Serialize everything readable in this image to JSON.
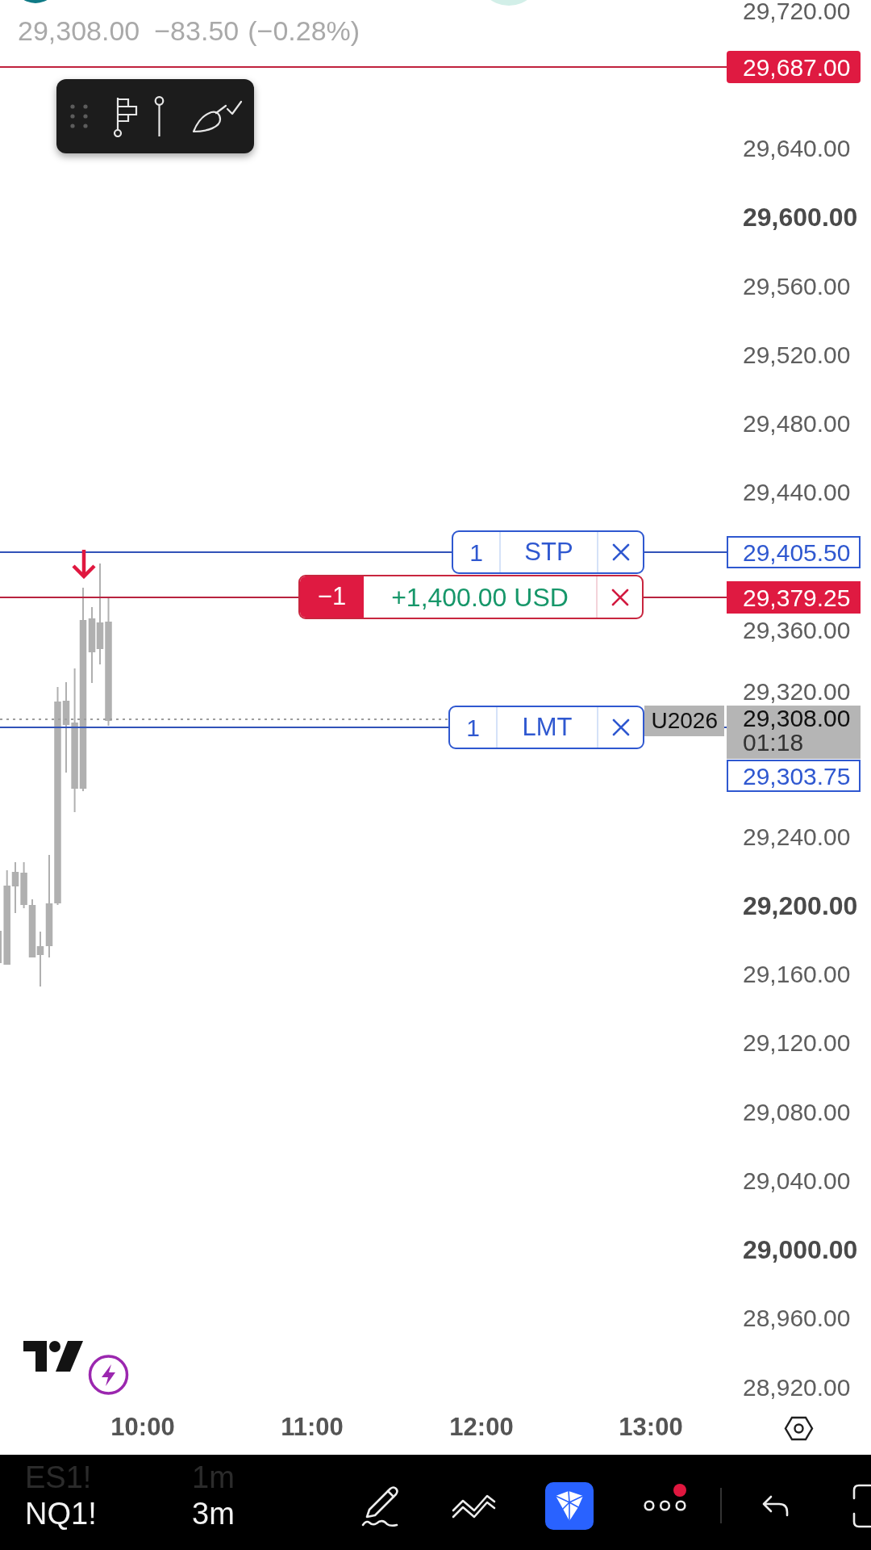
{
  "header": {
    "price": "29,308.00",
    "change": "−83.50",
    "change_percent": "(−0.28%)"
  },
  "price_lines": [
    {
      "kind": "price_line",
      "price": "29,687.00"
    },
    {
      "kind": "order",
      "quantity": "1",
      "order_type": "STP",
      "price": "29,405.50"
    },
    {
      "kind": "position",
      "quantity": "−1",
      "pnl": "+1,400.00 USD",
      "price": "29,379.25"
    },
    {
      "kind": "last_price",
      "symbol": "U2026",
      "price": "29,308.00",
      "countdown": "01:18"
    },
    {
      "kind": "order",
      "quantity": "1",
      "order_type": "LMT",
      "price": "29,303.75"
    }
  ],
  "price_axis": {
    "labels": [
      {
        "text": "29,720.00",
        "major": false
      },
      {
        "text": "29,640.00",
        "major": false
      },
      {
        "text": "29,600.00",
        "major": true
      },
      {
        "text": "29,560.00",
        "major": false
      },
      {
        "text": "29,520.00",
        "major": false
      },
      {
        "text": "29,480.00",
        "major": false
      },
      {
        "text": "29,440.00",
        "major": false
      },
      {
        "text": "29,360.00",
        "major": false
      },
      {
        "text": "29,320.00",
        "major": false
      },
      {
        "text": "29,240.00",
        "major": false
      },
      {
        "text": "29,200.00",
        "major": true
      },
      {
        "text": "29,160.00",
        "major": false
      },
      {
        "text": "29,120.00",
        "major": false
      },
      {
        "text": "29,080.00",
        "major": false
      },
      {
        "text": "29,040.00",
        "major": false
      },
      {
        "text": "29,000.00",
        "major": true
      },
      {
        "text": "28,960.00",
        "major": false
      },
      {
        "text": "28,920.00",
        "major": false
      }
    ]
  },
  "time_axis": {
    "labels": [
      "10:00",
      "11:00",
      "12:00",
      "13:00"
    ]
  },
  "bottom_bar": {
    "symbols": [
      {
        "label": "ES1!",
        "selected": false
      },
      {
        "label": "NQ1!",
        "selected": true
      }
    ],
    "intervals": [
      {
        "label": "1m",
        "selected": false
      },
      {
        "label": "3m",
        "selected": true
      }
    ],
    "tools": [
      {
        "kind": "draw",
        "selected": false,
        "notification": false
      },
      {
        "kind": "trend_lines",
        "selected": false,
        "notification": false
      },
      {
        "kind": "trading",
        "selected": true,
        "notification": false
      },
      {
        "kind": "more",
        "selected": false,
        "notification": true
      }
    ],
    "actions": [
      {
        "kind": "undo"
      },
      {
        "kind": "fullscreen"
      }
    ]
  }
}
